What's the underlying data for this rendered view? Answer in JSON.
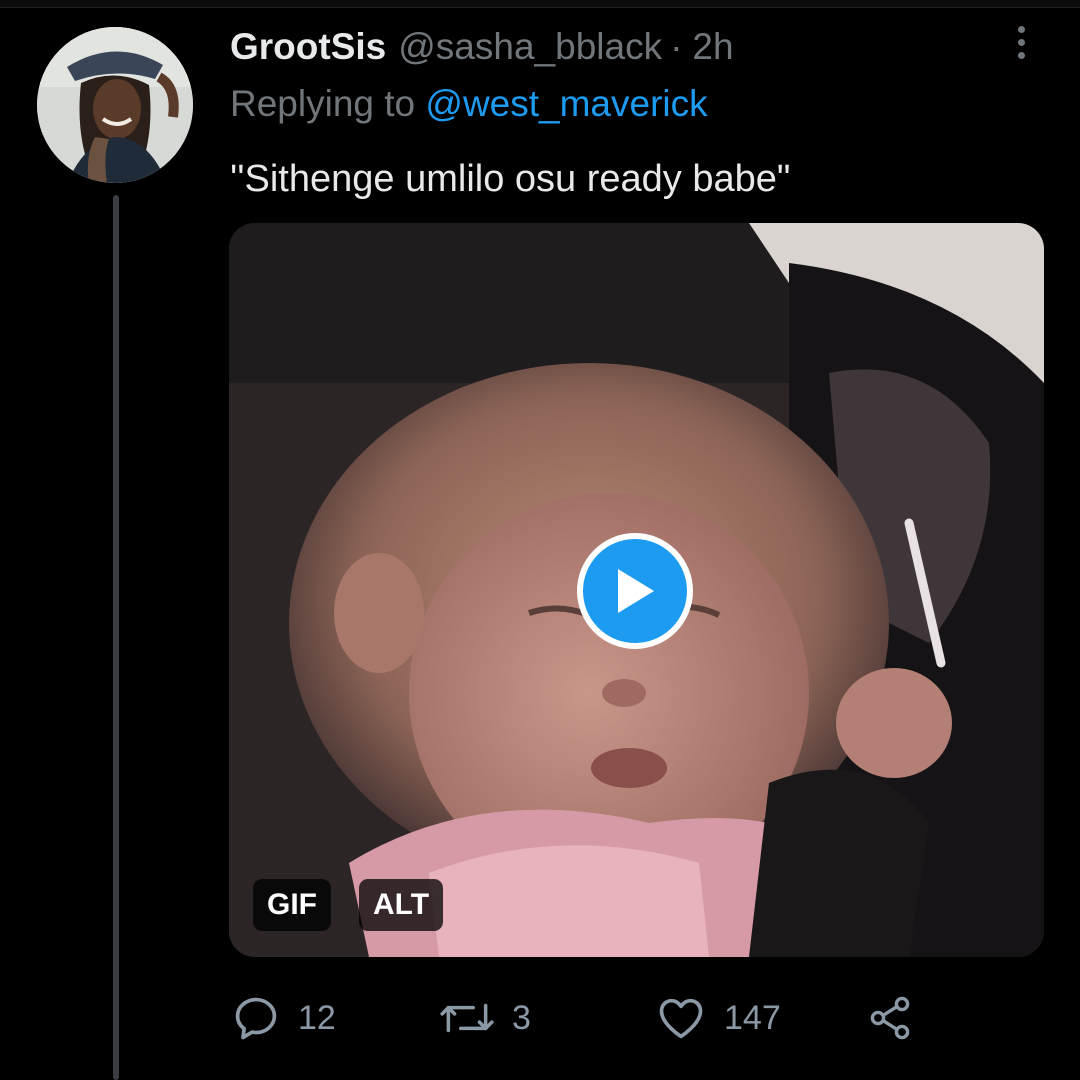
{
  "tweet": {
    "display_name": "GrootSis",
    "handle": "@sasha_bblack",
    "separator": "·",
    "time": "2h",
    "replying_prefix": "Replying to",
    "replying_to": "@west_maverick",
    "text": "''Sithenge umlilo osu ready babe\""
  },
  "media": {
    "badge_gif": "GIF",
    "badge_alt": "ALT",
    "play_icon": "play-icon"
  },
  "actions": {
    "reply_count": "12",
    "retweet_count": "3",
    "like_count": "147",
    "reply_icon": "reply-icon",
    "retweet_icon": "retweet-icon",
    "like_icon": "heart-icon",
    "share_icon": "share-icon"
  },
  "colors": {
    "background": "#000000",
    "accent": "#1d9bf0",
    "primary_text": "#e7e9ea",
    "secondary_text": "#71767b"
  }
}
